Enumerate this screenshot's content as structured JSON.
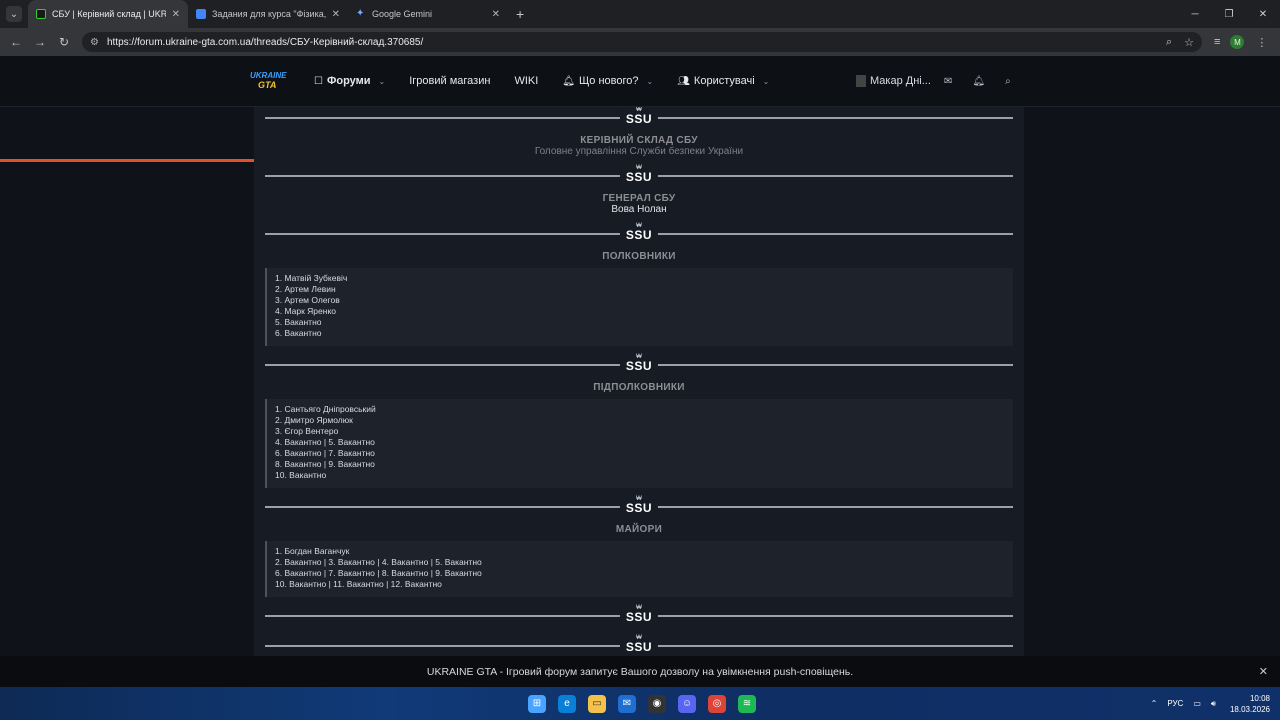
{
  "browser": {
    "tabs": [
      {
        "title": "СБУ | Керівний склад | UKRAINE",
        "active": true
      },
      {
        "title": "Задания для курса \"Фізика, 9-",
        "active": false
      },
      {
        "title": "Google Gemini",
        "active": false
      }
    ],
    "url": "https://forum.ukraine-gta.com.ua/threads/СБУ-Керівний-склад.370685/",
    "profile_initial": "M"
  },
  "site": {
    "logo_top": "UKRAINE",
    "logo_bottom": "GTA",
    "nav": {
      "forums": "Форуми",
      "shop": "Ігровий магазин",
      "wiki": "WIKI",
      "whats_new": "Що нового?",
      "users": "Користувачі"
    },
    "username": "Макар Дні..."
  },
  "emblem": {
    "glyph": "₩",
    "text": "SSU"
  },
  "sections": {
    "head": {
      "title": "КЕРІВНИЙ СКЛАД СБУ",
      "subtitle": "Головне управління Служби безпеки України"
    },
    "general": {
      "title": "ГЕНЕРАЛ СБУ",
      "name": "Вова Нолан"
    },
    "colonels": {
      "title": "ПОЛКОВНИКИ",
      "items": [
        "1. Матвій Зубкевіч",
        "2. Артем Левин",
        "3. Артем Олегов",
        "4. Марк Яренко",
        "5. Вакантно",
        "6. Вакантно"
      ]
    },
    "lt_colonels": {
      "title": "ПІДПОЛКОВНИКИ",
      "items": [
        "1. Сантьяго Дніпровський",
        "2. Дмитро Ярмолюк",
        "3. Єгор Вентеро",
        "4. Вакантно | 5. Вакантно",
        "6. Вакантно | 7. Вакантно",
        "8. Вакантно | 9. Вакантно",
        "10. Вакантно"
      ]
    },
    "majors": {
      "title": "МАЙОРИ",
      "items": [
        "1. Богдан Ваганчук",
        "2. Вакантно | 3. Вакантно | 4. Вакантно | 5. Вакантно",
        "6. Вакантно | 7. Вакантно | 8. Вакантно | 9. Вакантно",
        "10. Вакантно | 11. Вакантно | 12. Вакантно"
      ]
    }
  },
  "notification": {
    "text": "UKRAINE GTA - Ігровий форум запитує Вашого дозволу на увімкнення push-сповіщень."
  },
  "taskbar": {
    "lang": "РУС",
    "time": "10:08",
    "date": "18.03.2026"
  }
}
